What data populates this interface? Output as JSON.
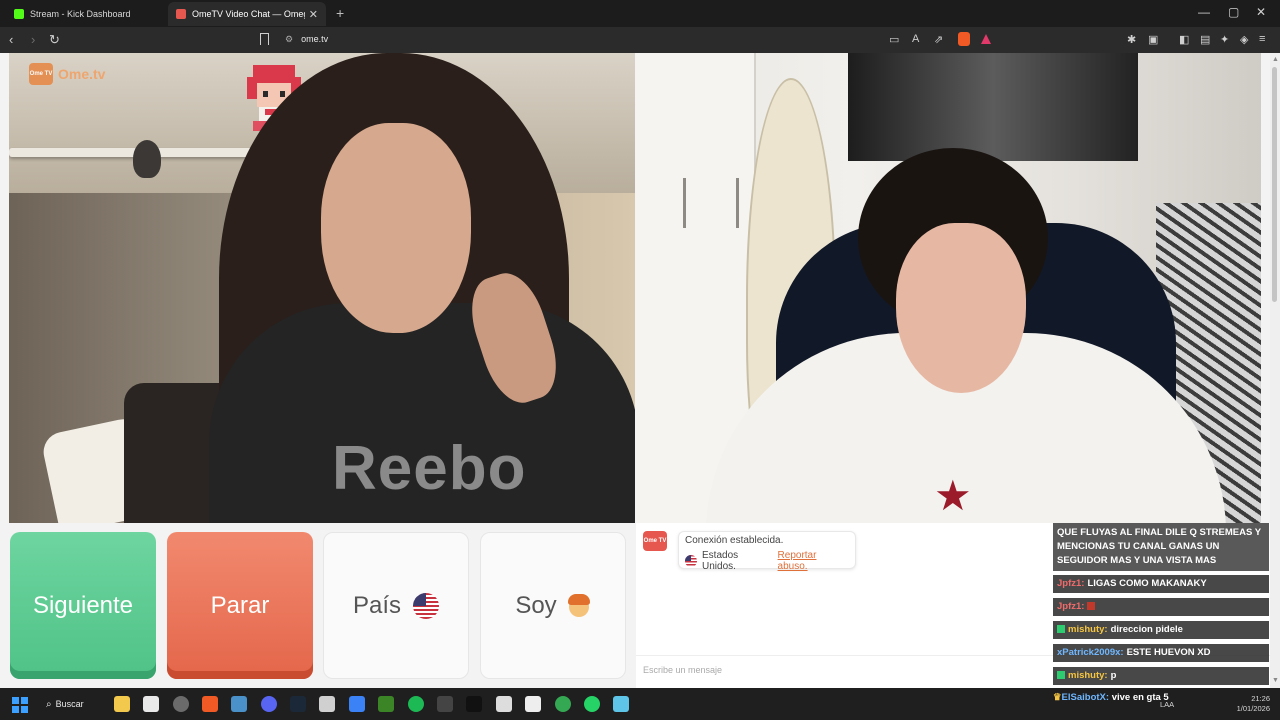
{
  "browser": {
    "tabs": [
      {
        "title": "Stream - Kick Dashboard"
      },
      {
        "title": "OmeTV Video Chat — Omegl"
      }
    ],
    "url": "ome.tv"
  },
  "brand": {
    "logo_text": "Ome.tv",
    "logo_box": "Ome TV"
  },
  "videos": {
    "left_shirt_text": "Reebo"
  },
  "controls": {
    "next_label": "Siguiente",
    "stop_label": "Parar",
    "country_label": "País",
    "gender_label": "Soy"
  },
  "chat": {
    "system_line1": "Conexión establecida.",
    "system_country": "Estados Unidos.",
    "report_label": "Reportar abuso.",
    "input_placeholder": "Escribe un mensaje"
  },
  "stream_overlay": {
    "highlight": "QUE FLUYAS AL FINAL DILE Q STREMEAS Y MENCIONAS TU CANAL GANAS UN SEGUIDOR MAS Y UNA VISTA MAS",
    "messages": [
      {
        "user": "Jpfz1:",
        "text": "LIGAS COMO MAKANAKY",
        "user_color": "#f06b6b"
      },
      {
        "user": "Jpfz1:",
        "text": "",
        "user_color": "#f06b6b"
      },
      {
        "user": "mishuty:",
        "text": "direccion pidele",
        "user_color": "#f5c542"
      },
      {
        "user": "xPatrick2009x:",
        "text": "ESTE HUEVON XD",
        "user_color": "#6fb7ff"
      },
      {
        "user": "mishuty:",
        "text": "p",
        "user_color": "#f5c542"
      }
    ],
    "ticker_user": "ElSaibotX:",
    "ticker_text": "vive en gta 5"
  },
  "taskbar": {
    "search_label": "Buscar",
    "lang": "LAA",
    "time": "21:26",
    "date": "1/01/2026"
  },
  "colors": {
    "next": "#4fc287",
    "stop": "#e4664a",
    "brand": "#e68a4a"
  }
}
